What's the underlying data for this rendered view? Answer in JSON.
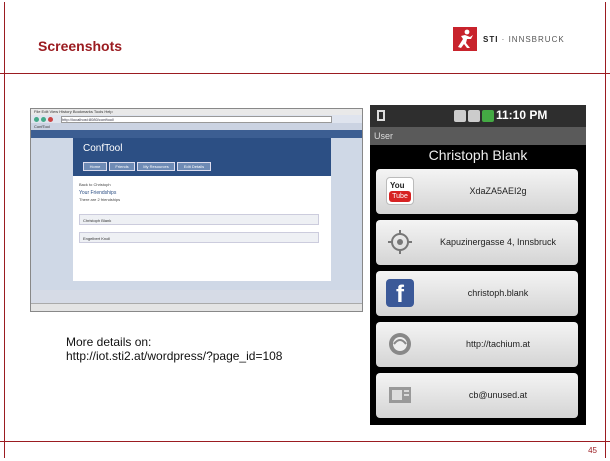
{
  "slide": {
    "title": "Screenshots",
    "logo_text_sti": "STI",
    "logo_text_rest": " · INNSBRUCK",
    "page_number": "45",
    "more_details_label": "More details on:",
    "more_details_url": "http://iot.sti2.at/wordpress/?page_id=108"
  },
  "browser": {
    "menu": "File  Edit  View  History  Bookmarks  Tools  Help",
    "url": "http://localhost:8080/conftool/",
    "tab": "ConfTool",
    "app_title": "ConfTool",
    "buttons": [
      "Home",
      "Friends",
      "My Resources",
      "Edit Details"
    ],
    "breadcrumb": "Back to Christoph",
    "section_title": "Your Friendships",
    "section_sub": "There are 2 friendships",
    "rows": [
      "Christoph Blank",
      "Engelbert Knoll"
    ]
  },
  "phone": {
    "clock": "11:10 PM",
    "app_title": "User",
    "contact_name": "Christoph Blank",
    "items": [
      {
        "icon": "youtube-icon",
        "text": "XdaZA5AEI2g"
      },
      {
        "icon": "location-icon",
        "text": "Kapuzinergasse 4, Innsbruck"
      },
      {
        "icon": "facebook-icon",
        "text": "christoph.blank"
      },
      {
        "icon": "web-icon",
        "text": "http://tachium.at"
      },
      {
        "icon": "email-icon",
        "text": "cb@unused.at"
      }
    ],
    "youtube_you": "You",
    "youtube_tube": "Tube"
  },
  "colors": {
    "accent": "#9b1c21",
    "logo_red": "#c8232c",
    "facebook_blue": "#3b5998"
  }
}
